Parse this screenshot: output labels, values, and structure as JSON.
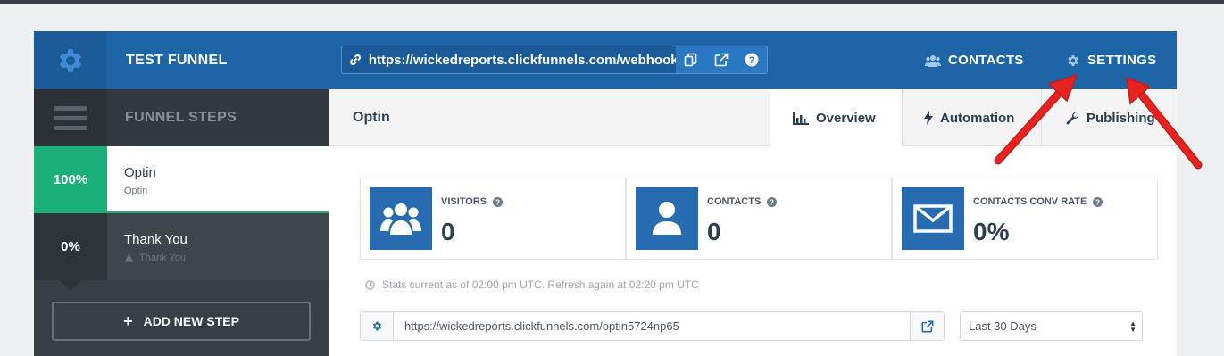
{
  "header": {
    "funnel_title": "TEST FUNNEL",
    "url": "https://wickedreports.clickfunnels.com/webhooks",
    "nav_contacts": "CONTACTS",
    "nav_settings": "SETTINGS"
  },
  "sidebar": {
    "title": "FUNNEL STEPS",
    "steps": [
      {
        "percent": "100%",
        "name": "Optin",
        "sub": "Optin"
      },
      {
        "percent": "0%",
        "name": "Thank You",
        "sub": "Thank You"
      }
    ],
    "add_step_label": "ADD NEW STEP"
  },
  "main": {
    "page_name": "Optin",
    "tabs": [
      {
        "label": "Overview",
        "icon": "bar-chart-icon"
      },
      {
        "label": "Automation",
        "icon": "bolt-icon"
      },
      {
        "label": "Publishing",
        "icon": "wrench-icon"
      }
    ],
    "stats": [
      {
        "label": "VISITORS",
        "value": "0",
        "icon": "group-icon"
      },
      {
        "label": "CONTACTS",
        "value": "0",
        "icon": "user-icon"
      },
      {
        "label": "CONTACTS CONV RATE",
        "value": "0%",
        "icon": "envelope-icon"
      }
    ],
    "stats_note": "Stats current as of 02:00 pm UTC. Refresh again at 02:20 pm UTC",
    "page_url": "https://wickedreports.clickfunnels.com/optin5724np65",
    "date_range": "Last 30 Days"
  },
  "colors": {
    "header_blue": "#1e65a8",
    "sidebar_dark": "#3a3f45",
    "step_green": "#1bb079",
    "stat_icon_blue": "#276bb0",
    "annotation_red": "#e8231f"
  }
}
